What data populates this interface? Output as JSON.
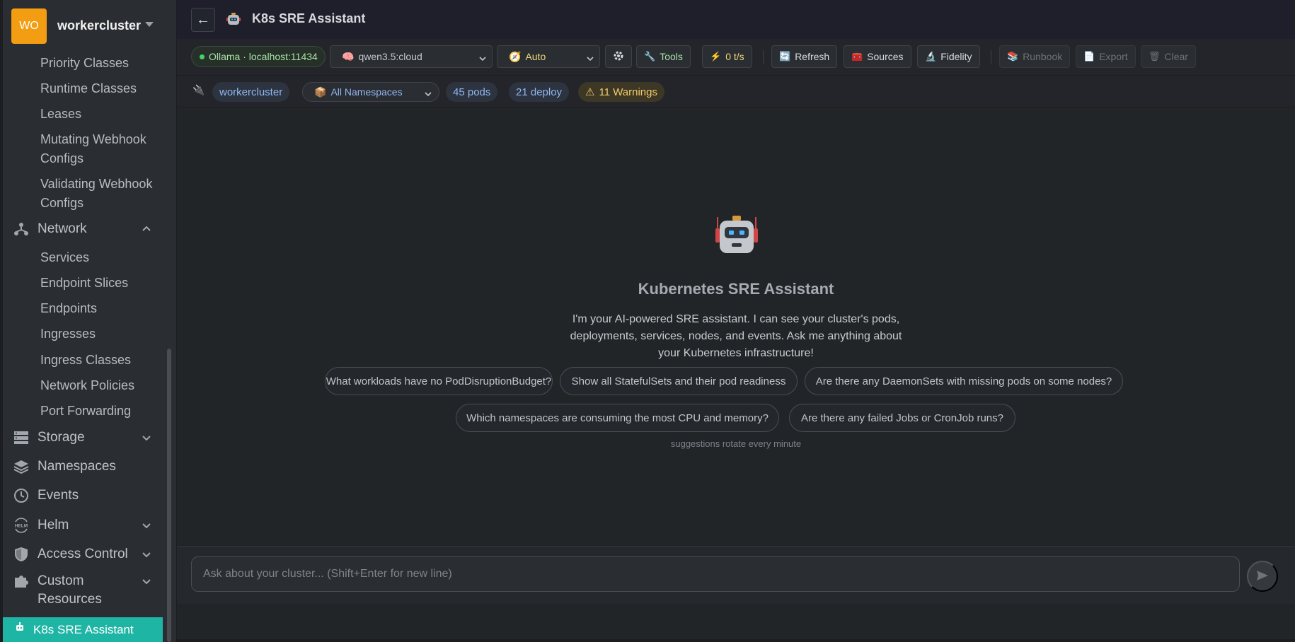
{
  "sidebar": {
    "cluster": {
      "badge": "WO",
      "name": "workercluster"
    },
    "sub_items_top": [
      {
        "label": "Priority Classes"
      },
      {
        "label": "Runtime Classes"
      },
      {
        "label": "Leases"
      },
      {
        "label": "Mutating Webhook Configs"
      },
      {
        "label": "Validating Webhook Configs"
      }
    ],
    "network": {
      "label": "Network",
      "expanded": true,
      "items": [
        {
          "label": "Services"
        },
        {
          "label": "Endpoint Slices"
        },
        {
          "label": "Endpoints"
        },
        {
          "label": "Ingresses"
        },
        {
          "label": "Ingress Classes"
        },
        {
          "label": "Network Policies"
        },
        {
          "label": "Port Forwarding"
        }
      ]
    },
    "main_items": [
      {
        "label": "Storage",
        "icon": "storage-icon",
        "chevron": "down"
      },
      {
        "label": "Namespaces",
        "icon": "layers-icon"
      },
      {
        "label": "Events",
        "icon": "clock-icon"
      },
      {
        "label": "Helm",
        "icon": "helm-icon",
        "chevron": "down"
      },
      {
        "label": "Access Control",
        "icon": "shield-icon",
        "chevron": "down"
      },
      {
        "label": "Custom Resources",
        "icon": "puzzle-icon",
        "chevron": "down"
      }
    ],
    "active_item": {
      "label": "K8s SRE Assistant",
      "icon": "robot-icon"
    }
  },
  "header": {
    "back_label": "←",
    "title": "K8s SRE Assistant"
  },
  "toolbar": {
    "status": "Ollama · localhost:11434",
    "model": "qwen3.5:cloud",
    "mode": "Auto",
    "tools": "Tools",
    "rate": "0 t/s",
    "refresh": "Refresh",
    "sources": "Sources",
    "fidelity": "Fidelity",
    "runbook": "Runbook",
    "export": "Export",
    "clear": "Clear"
  },
  "context": {
    "cluster": "workercluster",
    "namespace": "All Namespaces",
    "pods": "45 pods",
    "deploy": "21 deploy",
    "warnings": "11 Warnings"
  },
  "hero": {
    "title": "Kubernetes SRE Assistant",
    "description": "I'm your AI-powered SRE assistant. I can see your cluster's pods, deployments, services, nodes, and events. Ask me anything about your Kubernetes infrastructure!",
    "suggestions": [
      "What workloads have no PodDisruptionBudget?",
      "Show all StatefulSets and their pod readiness",
      "Are there any DaemonSets with missing pods on some nodes?",
      "Which namespaces are consuming the most CPU and memory?",
      "Are there any failed Jobs or CronJob runs?"
    ],
    "note": "suggestions rotate every minute"
  },
  "composer": {
    "placeholder": "Ask about your cluster... (Shift+Enter for new line)",
    "value": ""
  },
  "colors": {
    "accent": "#1fb5a5",
    "cluster_badge": "#f29d12",
    "status_dot": "#3fd46a",
    "warning": "#f0cc6a"
  }
}
